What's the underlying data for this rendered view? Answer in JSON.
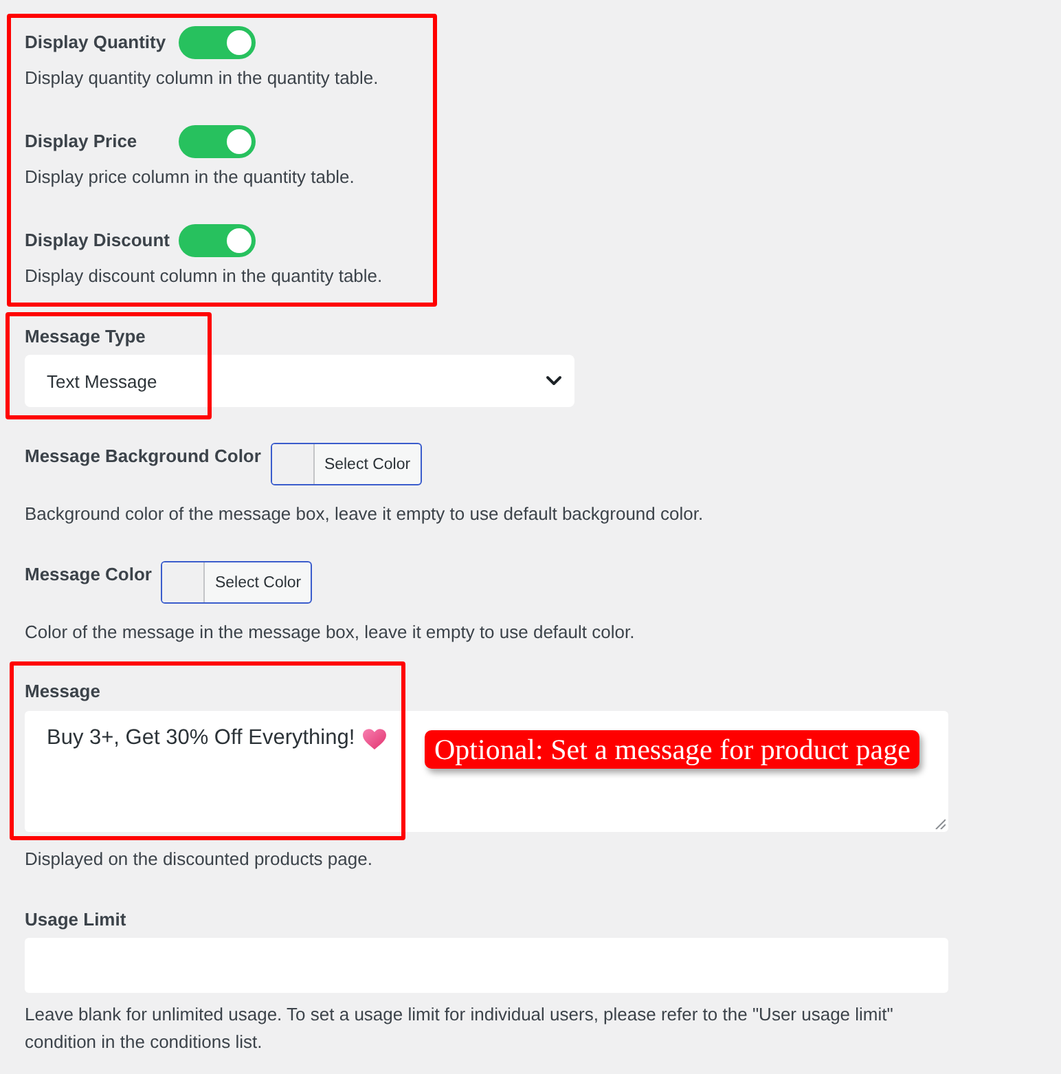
{
  "display_toggles": {
    "highlighted": true,
    "items": [
      {
        "label": "Display Quantity",
        "on": true,
        "description": "Display quantity column in the quantity table."
      },
      {
        "label": "Display Price",
        "on": true,
        "description": "Display price column in the quantity table."
      },
      {
        "label": "Display Discount",
        "on": true,
        "description": "Display discount column in the quantity table."
      }
    ]
  },
  "message_type": {
    "label": "Message Type",
    "value": "Text Message",
    "highlighted": true
  },
  "color_settings": [
    {
      "label": "Message Background Color",
      "button": "Select Color",
      "description": "Background color of the message box, leave it empty to use default background color."
    },
    {
      "label": "Message Color",
      "button": "Select Color",
      "description": "Color of the message in the message box, leave it empty to use default color."
    }
  ],
  "message": {
    "label": "Message",
    "value": "Buy 3+, Get 30% Off Everything!",
    "highlighted": true,
    "callout": "Optional: Set a message for product page",
    "description": "Displayed on the discounted products page."
  },
  "usage_limit": {
    "label": "Usage Limit",
    "description": "Leave blank for unlimited usage. To set a usage limit for individual users, please refer to the \"User usage limit\" condition in the conditions list."
  }
}
